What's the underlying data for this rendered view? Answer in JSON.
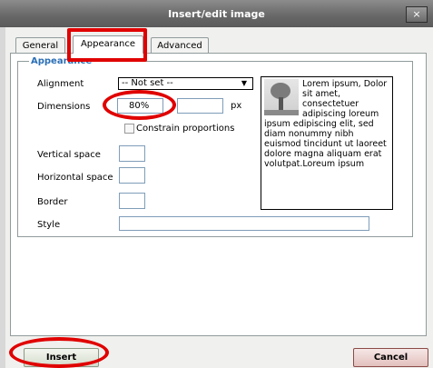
{
  "dialog": {
    "title": "Insert/edit image",
    "close_glyph": "×"
  },
  "tabs": [
    {
      "label": "General"
    },
    {
      "label": "Appearance"
    },
    {
      "label": "Advanced"
    }
  ],
  "appearance": {
    "legend": "Appearance",
    "alignment_label": "Alignment",
    "alignment_value": "-- Not set --",
    "dimensions_label": "Dimensions",
    "width_value": "80%",
    "height_value": "",
    "unit": "px",
    "constrain_label": "Constrain proportions",
    "vspace_label": "Vertical space",
    "hspace_label": "Horizontal space",
    "border_label": "Border",
    "style_label": "Style",
    "preview_text": "Lorem ipsum, Dolor sit amet, consectetuer adipiscing loreum ipsum edipiscing elit, sed diam nonummy nibh euismod tincidunt ut laoreet dolore magna aliquam erat volutpat.Loreum ipsum"
  },
  "buttons": {
    "insert": "Insert",
    "cancel": "Cancel"
  },
  "colors": {
    "highlight": "#e00000",
    "legend": "#2b6fb6"
  }
}
